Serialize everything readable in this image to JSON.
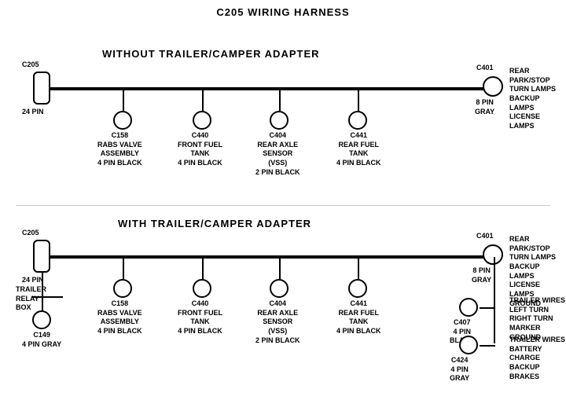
{
  "page": {
    "title": "C205 WIRING HARNESS"
  },
  "top_section": {
    "title": "WITHOUT  TRAILER/CAMPER  ADAPTER",
    "left_connector": {
      "id": "C205",
      "desc": "24 PIN"
    },
    "right_connector": {
      "id": "C401",
      "desc": "8 PIN\nGRAY",
      "labels": "REAR PARK/STOP\nTURN LAMPS\nBACKUP LAMPS\nLICENSE LAMPS"
    },
    "connectors": [
      {
        "id": "C158",
        "desc": "RABS VALVE\nASSEMBLY\n4 PIN BLACK"
      },
      {
        "id": "C440",
        "desc": "FRONT FUEL\nTANK\n4 PIN BLACK"
      },
      {
        "id": "C404",
        "desc": "REAR AXLE\nSENSOR\n(VSS)\n2 PIN BLACK"
      },
      {
        "id": "C441",
        "desc": "REAR FUEL\nTANK\n4 PIN BLACK"
      }
    ]
  },
  "bottom_section": {
    "title": "WITH  TRAILER/CAMPER  ADAPTER",
    "left_connector": {
      "id": "C205",
      "desc": "24 PIN"
    },
    "right_connector": {
      "id": "C401",
      "desc": "8 PIN\nGRAY",
      "labels": "REAR PARK/STOP\nTURN LAMPS\nBACKUP LAMPS\nLICENSE LAMPS\nGROUND"
    },
    "trailer_relay": {
      "label": "TRAILER\nRELAY\nBOX"
    },
    "c149": {
      "id": "C149",
      "desc": "4 PIN GRAY"
    },
    "connectors": [
      {
        "id": "C158",
        "desc": "RABS VALVE\nASSEMBLY\n4 PIN BLACK"
      },
      {
        "id": "C440",
        "desc": "FRONT FUEL\nTANK\n4 PIN BLACK"
      },
      {
        "id": "C404",
        "desc": "REAR AXLE\nSENSOR\n(VSS)\n2 PIN BLACK"
      },
      {
        "id": "C441",
        "desc": "REAR FUEL\nTANK\n4 PIN BLACK"
      }
    ],
    "right_connectors": [
      {
        "id": "C407",
        "desc": "4 PIN\nBLACK",
        "labels": "TRAILER WIRES\nLEFT TURN\nRIGHT TURN\nMARKER\nGROUND"
      },
      {
        "id": "C424",
        "desc": "4 PIN\nGRAY",
        "labels": "TRAILER WIRES\nBATTERY CHARGE\nBACKUP\nBRAKES"
      }
    ]
  }
}
